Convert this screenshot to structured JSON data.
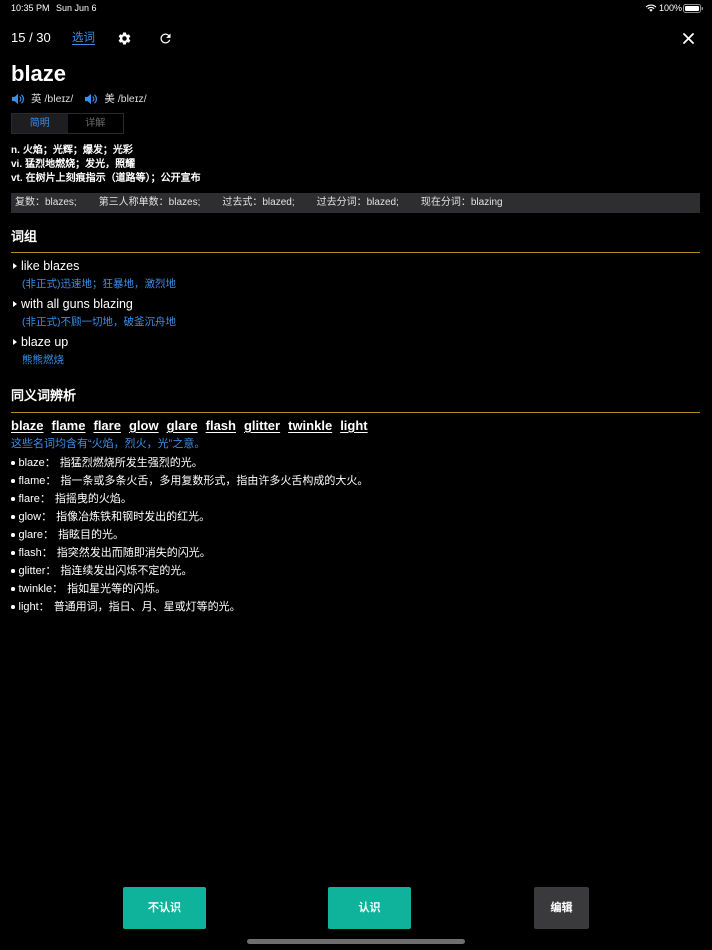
{
  "status_bar": {
    "time": "10:35 PM",
    "date": "Sun Jun 6",
    "battery_text": "100%",
    "battery_level": 1.0
  },
  "header": {
    "counter": "15 / 30",
    "select_words_link": "选词",
    "icons": {
      "settings": "gear-icon",
      "refresh": "refresh-icon",
      "close": "close-icon"
    }
  },
  "word": {
    "headword": "blaze",
    "pronunciations": [
      {
        "region": "英",
        "ipa": "/bleɪz/",
        "icon": "speaker-icon"
      },
      {
        "region": "美",
        "ipa": "/bleɪz/",
        "icon": "speaker-icon"
      }
    ],
    "tabs": [
      {
        "label": "简明",
        "selected": true
      },
      {
        "label": "详解",
        "selected": false
      }
    ],
    "definitions": [
      {
        "pos": "n.",
        "meaning": "火焰；光辉；爆发；光彩"
      },
      {
        "pos": "vi.",
        "meaning": "猛烈地燃烧；发光，照耀"
      },
      {
        "pos": "vt.",
        "meaning": "在树片上刻痕指示（道路等）；公开宣布"
      }
    ],
    "word_forms": [
      "复数：blazes;",
      "第三人称单数：blazes;",
      "过去式：blazed;",
      "过去分词：blazed;",
      "现在分词：blazing"
    ]
  },
  "phrases": {
    "title": "词组",
    "items": [
      {
        "phrase": "like blazes",
        "meaning": "(非正式)迅速地；狂暴地，激烈地"
      },
      {
        "phrase": "with all guns blazing",
        "meaning": "(非正式)不顾一切地，破釜沉舟地"
      },
      {
        "phrase": "blaze up",
        "meaning": "熊熊燃烧"
      }
    ]
  },
  "synonyms": {
    "title": "同义词辨析",
    "words": [
      "blaze",
      "flame",
      "flare",
      "glow",
      "glare",
      "flash",
      "glitter",
      "twinkle",
      "light"
    ],
    "summary": "这些名词均含有“火焰，烈火，光”之意。",
    "entries": [
      {
        "term": "blaze：",
        "desc": "指猛烈燃烧所发生强烈的光。"
      },
      {
        "term": "flame：",
        "desc": "指一条或多条火舌，多用复数形式，指由许多火舌构成的大火。"
      },
      {
        "term": "flare：",
        "desc": "指摇曳的火焰。"
      },
      {
        "term": "glow：",
        "desc": "指像冶炼铁和钢时发出的红光。"
      },
      {
        "term": "glare：",
        "desc": "指眩目的光。"
      },
      {
        "term": "flash：",
        "desc": "指突然发出而随即消失的闪光。"
      },
      {
        "term": "glitter：",
        "desc": "指连续发出闪烁不定的光。"
      },
      {
        "term": "twinkle：",
        "desc": "指如星光等的闪烁。"
      },
      {
        "term": "light：",
        "desc": "普通用词，指日、月、星或灯等的光。"
      }
    ]
  },
  "actions": {
    "unknown_label": "不认识",
    "known_label": "认识",
    "edit_label": "编辑"
  },
  "theme": {
    "accent": "#3a8ee6",
    "divider": "#b0921a",
    "teal": "#0fb39c",
    "edit_button": "#3a3a3c",
    "forms_bar": "#2e2e30",
    "home_indicator": "#6e6e6e"
  }
}
